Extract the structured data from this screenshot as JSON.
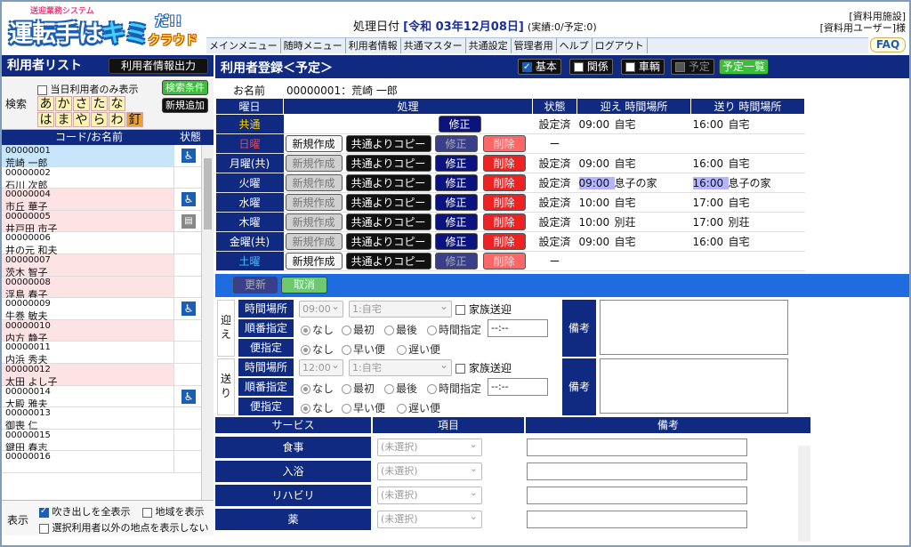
{
  "header": {
    "logo_sub": "送迎業務システム",
    "logo_main": "運転手は",
    "logo_kimi": "キミ",
    "logo_da": "だ!!",
    "logo_cloud": "クラウド",
    "date_label": "処理日付",
    "date_value": "[令和 03年12月08日]",
    "date_status": "(実績:0/予定:0)",
    "facility": "[資料用施設]",
    "user": "[資料用ユーザー]様",
    "faq": "FAQ"
  },
  "menu": [
    "メインメニュー",
    "随時メニュー",
    "利用者情報",
    "共通マスター",
    "共通設定",
    "管理者用",
    "ヘルプ",
    "ログアウト"
  ],
  "left": {
    "title": "利用者リスト",
    "export_button": "利用者情報出力",
    "search_label": "検索",
    "today_only": "当日利用者のみ表示",
    "search_cond_button": "検索条件",
    "new_add_button": "新規追加",
    "kana_row1": [
      "あ",
      "か",
      "さ",
      "た",
      "な"
    ],
    "kana_row2": [
      "は",
      "ま",
      "や",
      "ら",
      "わ",
      "釘"
    ],
    "col_code": "コード/お名前",
    "col_status": "状態",
    "users": [
      {
        "id": "00000001",
        "name": "荒崎 一郎",
        "icon": "wheelchair",
        "bg": "#c7e6fb"
      },
      {
        "id": "00000002",
        "name": "石川 次郎",
        "icon": "",
        "bg": "#ffffff"
      },
      {
        "id": "00000004",
        "name": "市丘 華子",
        "icon": "wheelchair",
        "bg": "#fde3e3"
      },
      {
        "id": "00000005",
        "name": "井戸田 市子",
        "icon": "bed",
        "bg": "#fde3e3"
      },
      {
        "id": "00000006",
        "name": "井の元 和夫",
        "icon": "",
        "bg": "#ffffff"
      },
      {
        "id": "00000007",
        "name": "茨木 智子",
        "icon": "",
        "bg": "#fde3e3"
      },
      {
        "id": "00000008",
        "name": "浮島 春子",
        "icon": "",
        "bg": "#fde3e3"
      },
      {
        "id": "00000009",
        "name": "牛巻 敏夫",
        "icon": "wheelchair",
        "bg": "#ffffff"
      },
      {
        "id": "00000010",
        "name": "内方 静子",
        "icon": "",
        "bg": "#fde3e3"
      },
      {
        "id": "00000011",
        "name": "内浜 秀夫",
        "icon": "",
        "bg": "#ffffff"
      },
      {
        "id": "00000012",
        "name": "太田 よし子",
        "icon": "",
        "bg": "#fde3e3"
      },
      {
        "id": "00000014",
        "name": "大殿 雅夫",
        "icon": "wheelchair",
        "bg": "#ffffff"
      },
      {
        "id": "00000013",
        "name": "御喪 仁",
        "icon": "",
        "bg": "#ffffff"
      },
      {
        "id": "00000015",
        "name": "鍵田 春志",
        "icon": "",
        "bg": "#ffffff"
      },
      {
        "id": "00000016",
        "name": "",
        "icon": "",
        "bg": "#ffffff"
      }
    ],
    "display_label": "表示",
    "show_balloon": "吹き出しを全表示",
    "show_area": "地域を表示",
    "hide_points": "選択利用者以外の地点を表示しない"
  },
  "right": {
    "title": "利用者登録＜予定＞",
    "toggles": [
      "基本",
      "関係",
      "車輌",
      "予定"
    ],
    "schedule_list_button": "予定一覧",
    "name_label": "お名前",
    "name_value": "00000001：荒崎 一郎",
    "cols": [
      "曜日",
      "処理",
      "状態",
      "迎え 時間場所",
      "送り 時間場所"
    ],
    "btn_new": "新規作成",
    "btn_copy": "共通よりコピー",
    "btn_edit": "修正",
    "btn_delete": "削除",
    "rows": [
      {
        "day": "共通",
        "color": "#ffd700",
        "status": "設定済",
        "pt": "09:00",
        "pp": "自宅",
        "dt": "16:00",
        "dp": "自宅"
      },
      {
        "day": "日曜",
        "color": "#ff4040",
        "status": "ー",
        "pt": "",
        "pp": "",
        "dt": "",
        "dp": ""
      },
      {
        "day": "月曜(共)",
        "color": "#ffffff",
        "status": "設定済",
        "pt": "09:00",
        "pp": "自宅",
        "dt": "16:00",
        "dp": "自宅"
      },
      {
        "day": "火曜",
        "color": "#ffffff",
        "status": "設定済",
        "pt": "09:00",
        "pp": "息子の家",
        "dt": "16:00",
        "dp": "息子の家"
      },
      {
        "day": "水曜",
        "color": "#ffffff",
        "status": "設定済",
        "pt": "10:00",
        "pp": "自宅",
        "dt": "17:00",
        "dp": "自宅"
      },
      {
        "day": "木曜",
        "color": "#ffffff",
        "status": "設定済",
        "pt": "10:00",
        "pp": "別荘",
        "dt": "17:00",
        "dp": "別荘"
      },
      {
        "day": "金曜(共)",
        "color": "#ffffff",
        "status": "設定済",
        "pt": "09:00",
        "pp": "自宅",
        "dt": "16:00",
        "dp": "自宅"
      },
      {
        "day": "土曜",
        "color": "#40c0ff",
        "status": "ー",
        "pt": "",
        "pp": "",
        "dt": "",
        "dp": ""
      }
    ],
    "update_button": "更新",
    "cancel_button": "取消",
    "pickup_label": "迎え",
    "dropoff_label": "送り",
    "time_place_label": "時間場所",
    "order_label": "順番指定",
    "flight_label": "便指定",
    "pickup_time": "09:00",
    "pickup_place": "1:自宅",
    "dropoff_time": "12:00",
    "dropoff_place": "1:自宅",
    "family": "家族送迎",
    "order_opts": [
      "なし",
      "最初",
      "最後",
      "時間指定"
    ],
    "time_blank": "--:--",
    "flight_opts": [
      "なし",
      "早い便",
      "遅い便"
    ],
    "remarks_label": "備考",
    "svc_cols": [
      "サービス",
      "項目",
      "備考"
    ],
    "services": [
      "食事",
      "入浴",
      "リハビリ",
      "薬"
    ],
    "svc_unselected": "(未選択)"
  }
}
